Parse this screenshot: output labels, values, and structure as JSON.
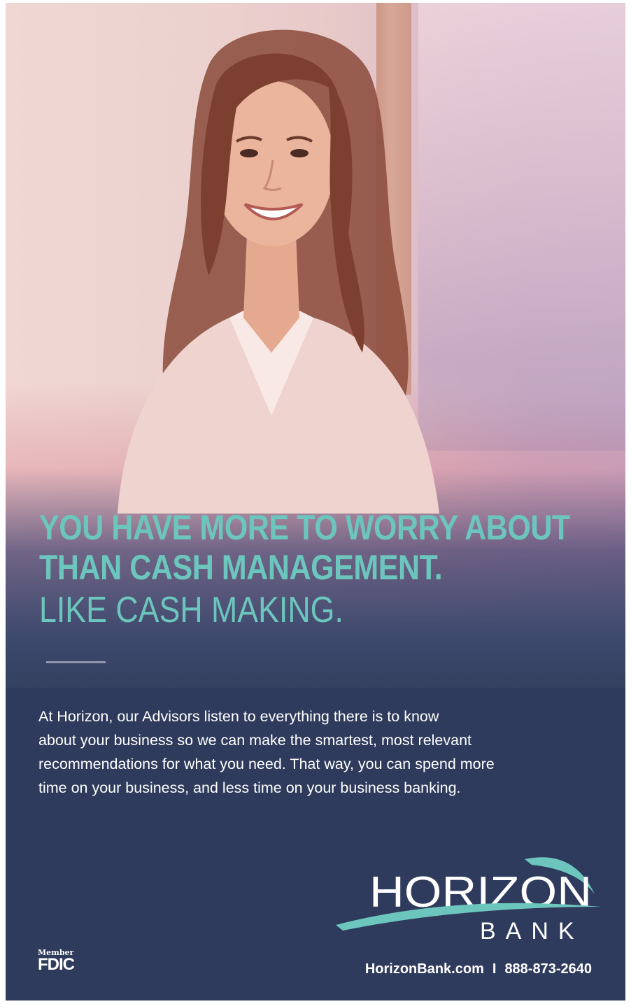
{
  "headline": {
    "line1": "YOU HAVE MORE TO WORRY ABOUT",
    "line2": "THAN CASH MANAGEMENT.",
    "line3": "LIKE CASH MAKING."
  },
  "body": {
    "line1": "At Horizon, our Advisors listen to everything there is to know",
    "line2": "about your business so we can make the smartest, most relevant",
    "line3": "recommendations for what you need. That way, you can spend more",
    "line4": "time on your business, and less time on your business banking."
  },
  "logo": {
    "name": "HORIZON",
    "sub": "BANK"
  },
  "fdic": {
    "member": "Member",
    "label": "FDIC"
  },
  "contact": {
    "website": "HorizonBank.com",
    "separator": "I",
    "phone": "888-873-2640"
  },
  "colors": {
    "accent_teal": "#6cc6bd",
    "navy": "#2f3b5c",
    "text_white": "#ffffff"
  }
}
